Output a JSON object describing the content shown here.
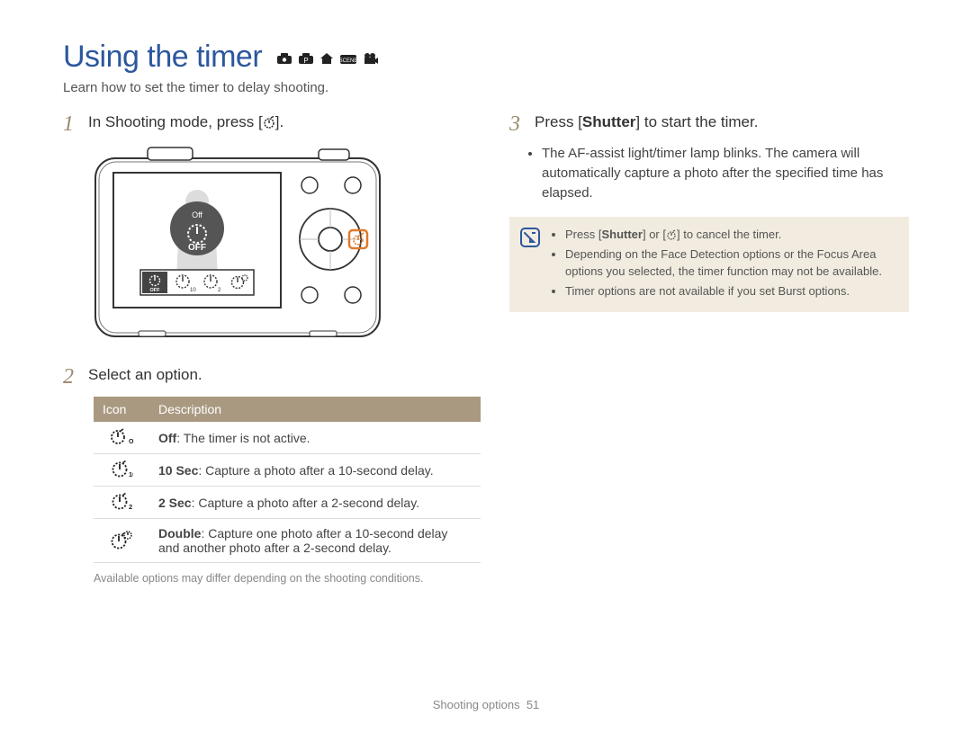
{
  "title": "Using the timer",
  "mode_icons": [
    "smart-icon",
    "program-icon",
    "house-icon",
    "scene-icon",
    "movie-icon"
  ],
  "subtitle": "Learn how to set the timer to delay shooting.",
  "steps": {
    "s1": {
      "num": "1",
      "text_prefix": "In Shooting mode, press [",
      "text_suffix": "]."
    },
    "s2": {
      "num": "2",
      "text": "Select an option."
    },
    "s3": {
      "num": "3",
      "prefix": "Press [",
      "bold": "Shutter",
      "suffix": "] to start the timer."
    }
  },
  "s3_bullet": "The AF-assist light/timer lamp blinks. The camera will automatically capture a photo after the specified time has elapsed.",
  "table": {
    "headers": {
      "icon": "Icon",
      "desc": "Description"
    },
    "rows": [
      {
        "icon": "timer-off-icon",
        "bold": "Off",
        "desc": ": The timer is not active."
      },
      {
        "icon": "timer-10-icon",
        "bold": "10 Sec",
        "desc": ": Capture a photo after a 10-second delay."
      },
      {
        "icon": "timer-2-icon",
        "bold": "2 Sec",
        "desc": ": Capture a photo after a 2-second delay."
      },
      {
        "icon": "timer-double-icon",
        "bold": "Double",
        "desc": ": Capture one photo after a 10-second delay and another photo after a 2-second delay."
      }
    ]
  },
  "table_footnote": "Available options may differ depending on the shooting conditions.",
  "notes": {
    "n1": {
      "prefix": "Press [",
      "bold": "Shutter",
      "mid": "] or [",
      "suffix": "] to cancel the timer."
    },
    "n2": "Depending on the Face Detection options or the Focus Area options you selected, the timer function may not be available.",
    "n3": "Timer options are not available if you set Burst options."
  },
  "camera_labels": {
    "off_text": "Off",
    "off_big": "OFF"
  },
  "footer": {
    "section": "Shooting options",
    "page": "51"
  }
}
